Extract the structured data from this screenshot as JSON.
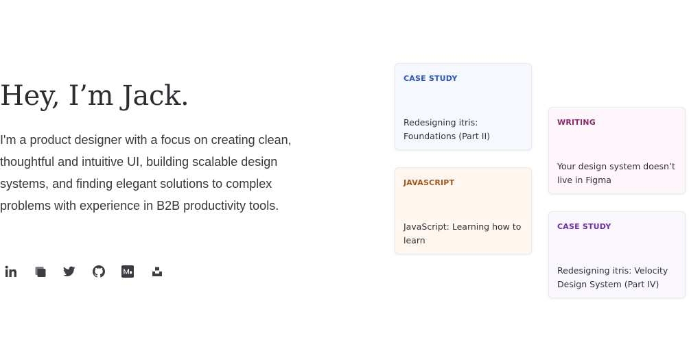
{
  "hero": {
    "title": "Hey, I’m Jack.",
    "bio": "I'm a product designer with a focus on creating clean, thoughtful and intuitive UI, building scalable design systems, and finding elegant solutions to complex problems with experience in B2B productivity tools."
  },
  "socials": [
    {
      "icon": "linkedin-icon"
    },
    {
      "icon": "cube-icon"
    },
    {
      "icon": "twitter-icon"
    },
    {
      "icon": "github-icon"
    },
    {
      "icon": "medium-icon"
    },
    {
      "icon": "unsplash-icon"
    }
  ],
  "cards": [
    {
      "tag": "CASE STUDY",
      "title": "Redesigning itris: Foundations (Part II)",
      "tag_color": "#2a55c4"
    },
    {
      "tag": "JAVASCRIPT",
      "title": "JavaScript: Learning how to learn",
      "tag_color": "#a1581a"
    },
    {
      "tag": "WRITING",
      "title": "Your design system doesn’t live in Figma",
      "tag_color": "#8a2a6a"
    },
    {
      "tag": "CASE STUDY",
      "title": "Redesigning itris: Velocity Design System (Part IV)",
      "tag_color": "#6a2fa8"
    }
  ],
  "colors": {
    "icon": "#3b3d42",
    "text": "#35373b"
  }
}
